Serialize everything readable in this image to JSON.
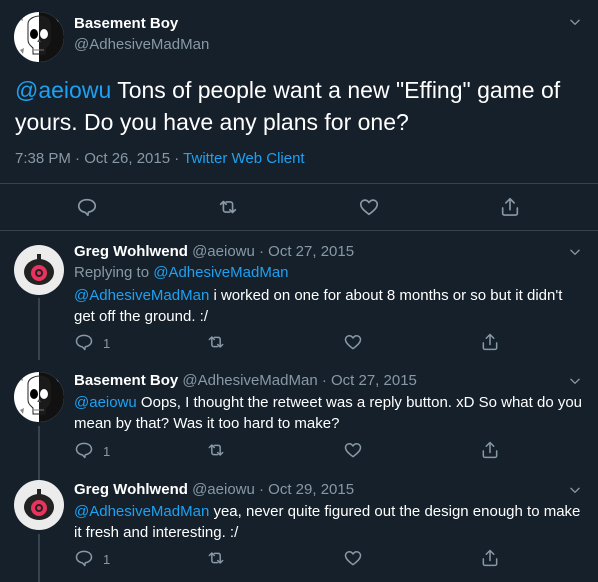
{
  "main_tweet": {
    "author_name": "Basement Boy",
    "author_handle": "@AdhesiveMadMan",
    "mention": "@aeiowu",
    "text": " Tons of people want a new \"Effing\" game of yours. Do you have any plans for one?",
    "time": "7:38 PM · Oct 26, 2015 · ",
    "client": "Twitter Web Client"
  },
  "replies": [
    {
      "author_name": "Greg Wohlwend",
      "meta": "@aeiowu · Oct 27, 2015",
      "replying_prefix": "Replying to ",
      "replying_to": "@AdhesiveMadMan",
      "mention": "@AdhesiveMadMan",
      "text": " i worked on one for about 8 months or so but it didn't get off the ground. :/",
      "reply_count": "1"
    },
    {
      "author_name": "Basement Boy",
      "meta": "@AdhesiveMadMan · Oct 27, 2015",
      "mention": "@aeiowu",
      "text": " Oops, I thought the retweet was a reply button. xD So what do you mean by that? Was it too hard to make?",
      "reply_count": "1"
    },
    {
      "author_name": "Greg Wohlwend",
      "meta": "@aeiowu · Oct 29, 2015",
      "mention": "@AdhesiveMadMan",
      "text": " yea, never quite figured out the design enough to make it fresh and interesting. :/",
      "reply_count": "1"
    }
  ],
  "colors": {
    "background": "#15202b",
    "accent": "#1da1f2",
    "muted": "#8899a6",
    "divider": "#38444d"
  },
  "icons": [
    "chevron-down-icon",
    "reply-icon",
    "retweet-icon",
    "like-icon",
    "share-icon"
  ]
}
